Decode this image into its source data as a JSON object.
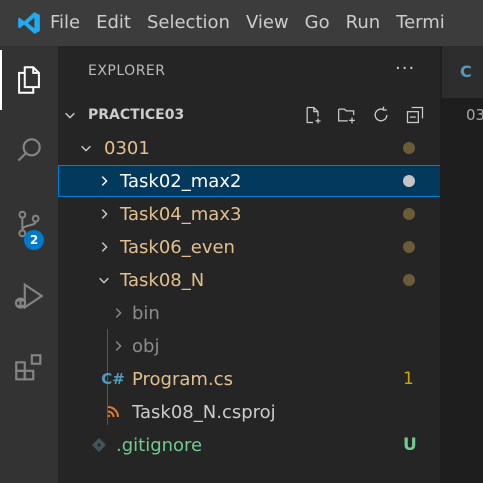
{
  "menu": [
    "File",
    "Edit",
    "Selection",
    "View",
    "Go",
    "Run",
    "Termi"
  ],
  "activity_badge": "2",
  "explorer": {
    "title": "EXPLORER",
    "more": "···",
    "root": "PRACTICE03"
  },
  "tree": {
    "folder_0301": "0301",
    "task02": "Task02_max2",
    "task04": "Task04_max3",
    "task06": "Task06_even",
    "task08": "Task08_N",
    "bin": "bin",
    "obj": "obj",
    "program": "Program.cs",
    "program_problems": "1",
    "csproj": "Task08_N.csproj",
    "gitignore": ".gitignore",
    "gitignore_status": "U"
  },
  "editor": {
    "breadcrumb": "03"
  },
  "colors": {
    "modified": "#e2c08d",
    "untracked": "#73c991",
    "selection": "#04395e",
    "accent": "#007acc"
  },
  "icons": {
    "activity": [
      "files-icon",
      "search-icon",
      "source-control-icon",
      "run-debug-icon",
      "extensions-icon"
    ],
    "explorer_actions": [
      "new-file-icon",
      "new-folder-icon",
      "refresh-icon",
      "collapse-all-icon"
    ]
  }
}
